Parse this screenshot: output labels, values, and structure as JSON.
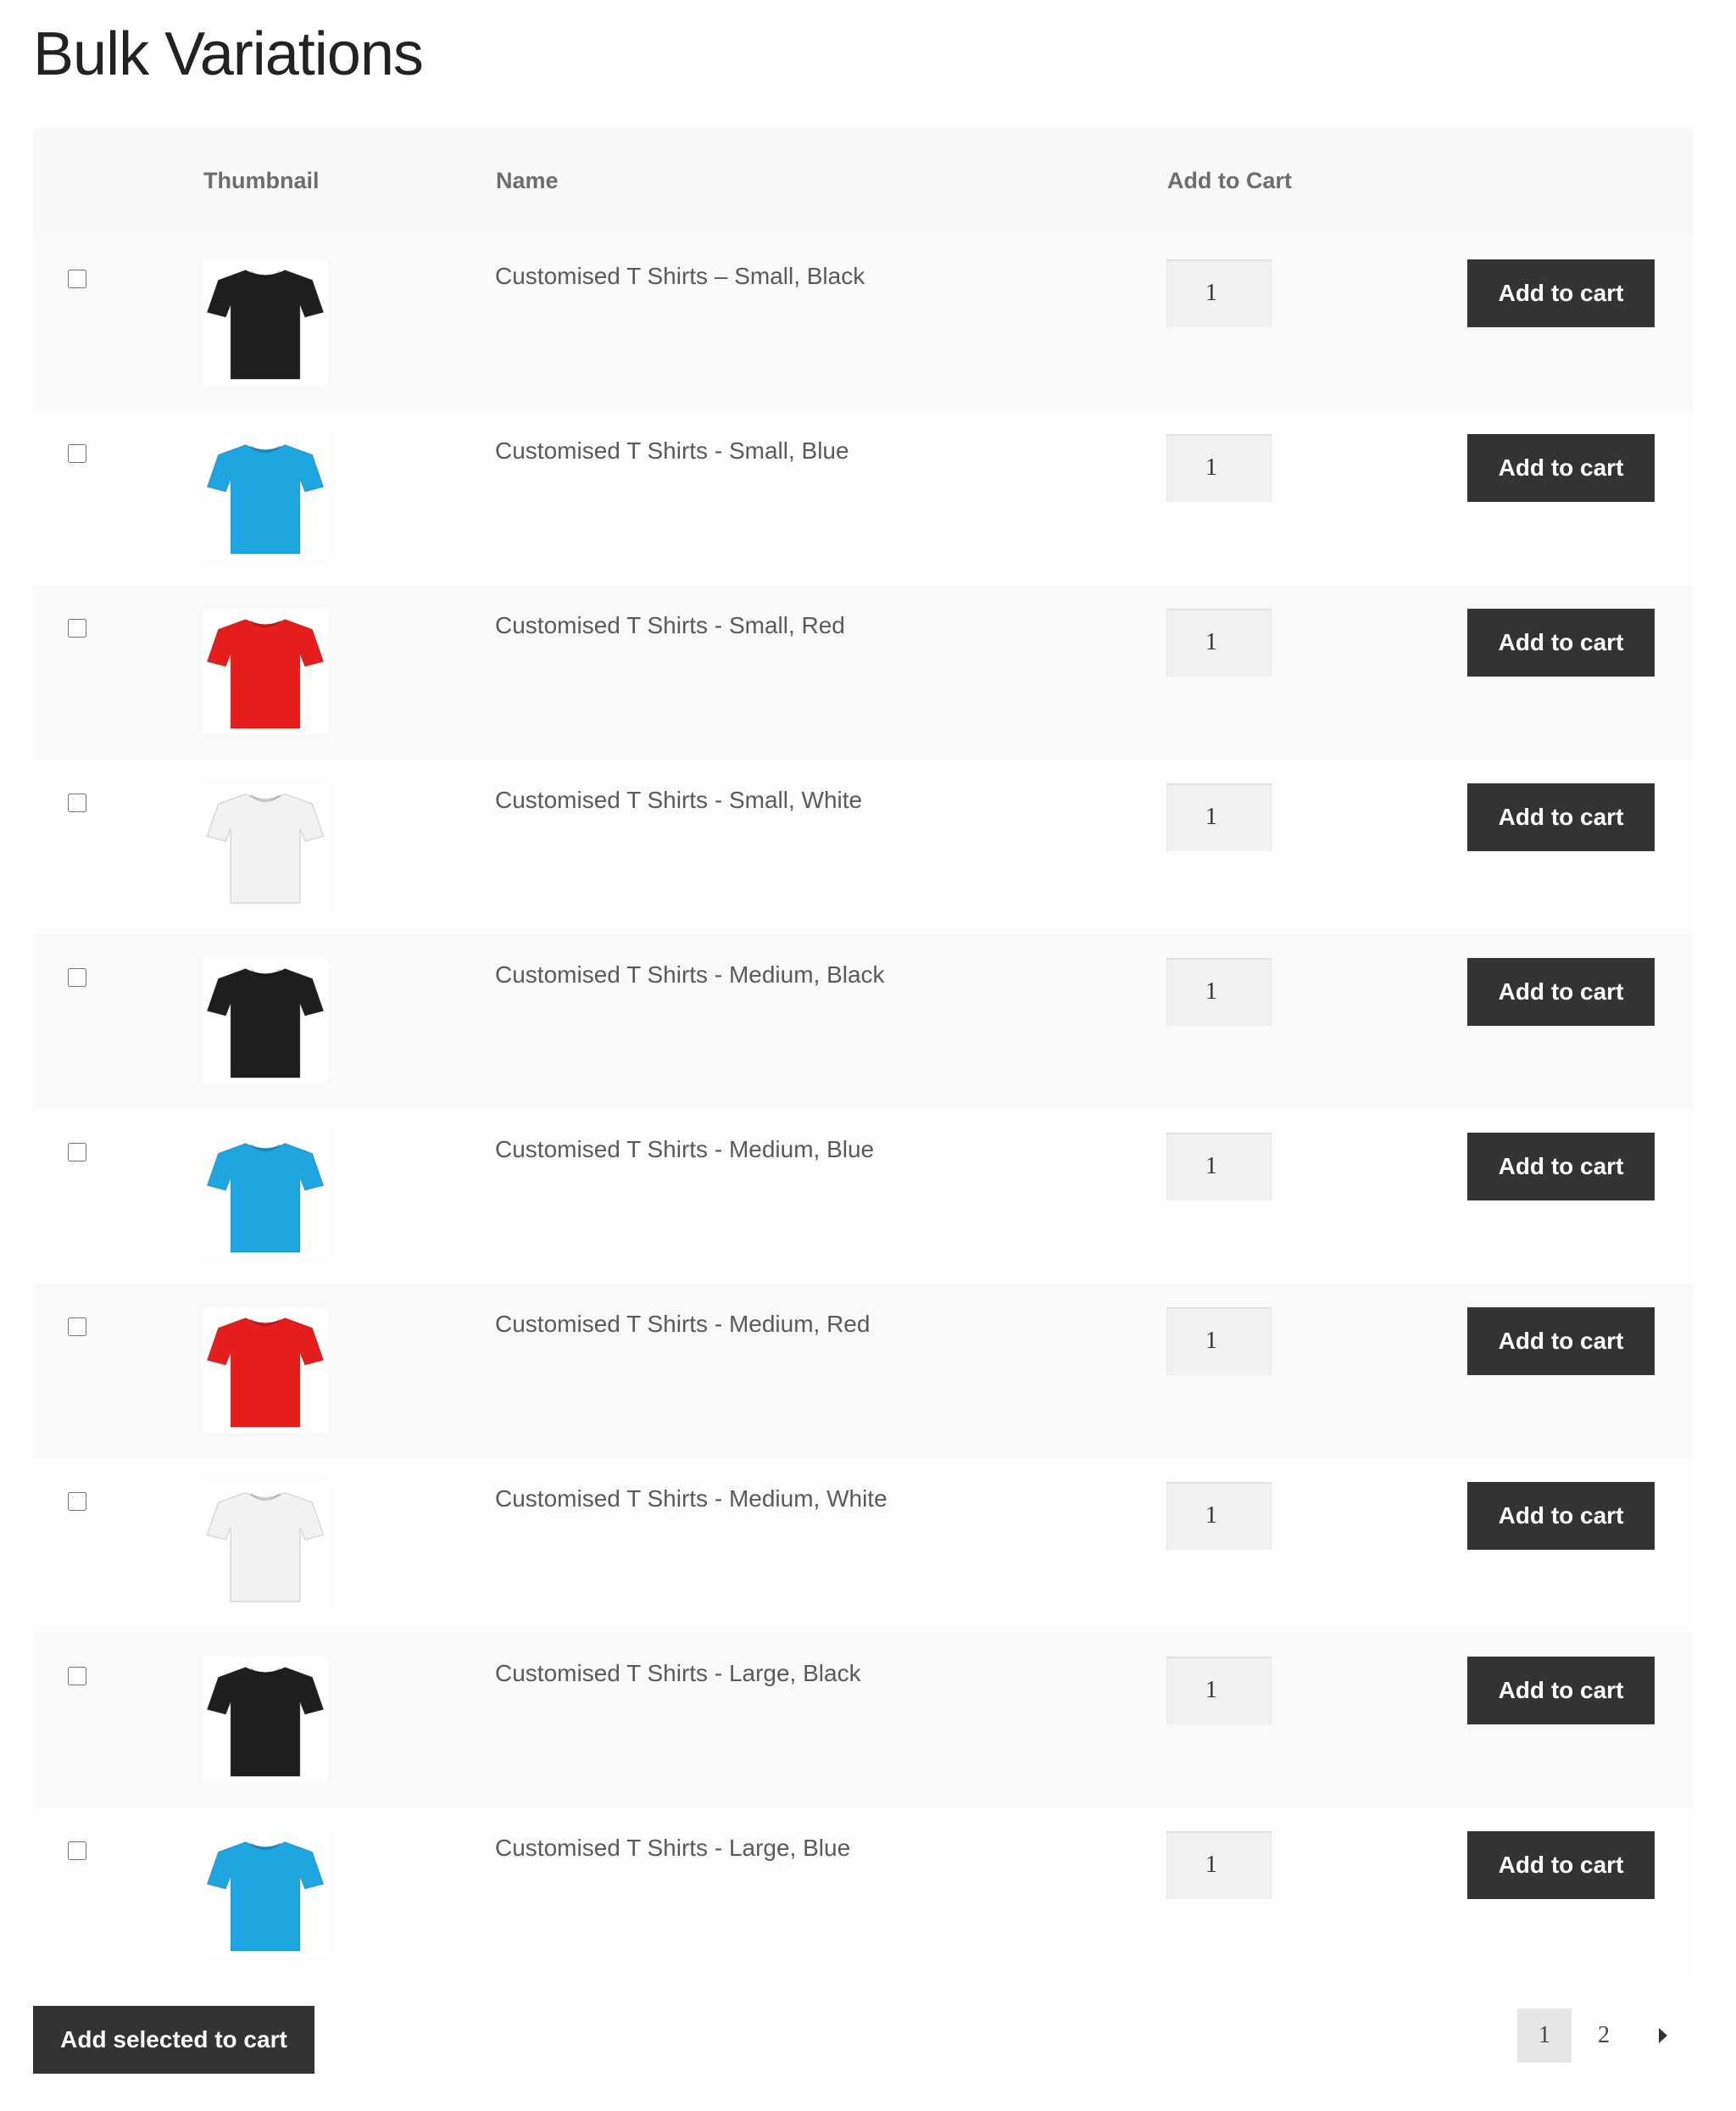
{
  "page": {
    "title": "Bulk Variations"
  },
  "table": {
    "headers": {
      "thumbnail": "Thumbnail",
      "name": "Name",
      "add_to_cart": "Add to Cart"
    },
    "rows": [
      {
        "name": "Customised T Shirts – Small, Black",
        "color": "#1e1e1e",
        "color_name": "black",
        "qty": "1",
        "button": "Add to cart"
      },
      {
        "name": "Customised T Shirts - Small, Blue",
        "color": "#1ea6e0",
        "color_name": "blue",
        "qty": "1",
        "button": "Add to cart"
      },
      {
        "name": "Customised T Shirts - Small, Red",
        "color": "#e61d1d",
        "color_name": "red",
        "qty": "1",
        "button": "Add to cart"
      },
      {
        "name": "Customised T Shirts - Small, White",
        "color": "#f2f2f2",
        "color_name": "white",
        "qty": "1",
        "button": "Add to cart"
      },
      {
        "name": "Customised T Shirts - Medium, Black",
        "color": "#1e1e1e",
        "color_name": "black",
        "qty": "1",
        "button": "Add to cart"
      },
      {
        "name": "Customised T Shirts - Medium, Blue",
        "color": "#1ea6e0",
        "color_name": "blue",
        "qty": "1",
        "button": "Add to cart"
      },
      {
        "name": "Customised T Shirts - Medium, Red",
        "color": "#e61d1d",
        "color_name": "red",
        "qty": "1",
        "button": "Add to cart"
      },
      {
        "name": "Customised T Shirts - Medium, White",
        "color": "#f2f2f2",
        "color_name": "white",
        "qty": "1",
        "button": "Add to cart"
      },
      {
        "name": "Customised T Shirts - Large, Black",
        "color": "#1e1e1e",
        "color_name": "black",
        "qty": "1",
        "button": "Add to cart"
      },
      {
        "name": "Customised T Shirts - Large, Blue",
        "color": "#1ea6e0",
        "color_name": "blue",
        "qty": "1",
        "button": "Add to cart"
      }
    ]
  },
  "footer": {
    "bulk_button": "Add selected to cart",
    "pagination": {
      "pages": [
        "1",
        "2"
      ],
      "current": "1",
      "next_icon": "caret-right-icon"
    }
  },
  "colors": {
    "button_bg": "#333333",
    "header_bg": "#f8f8f8"
  }
}
